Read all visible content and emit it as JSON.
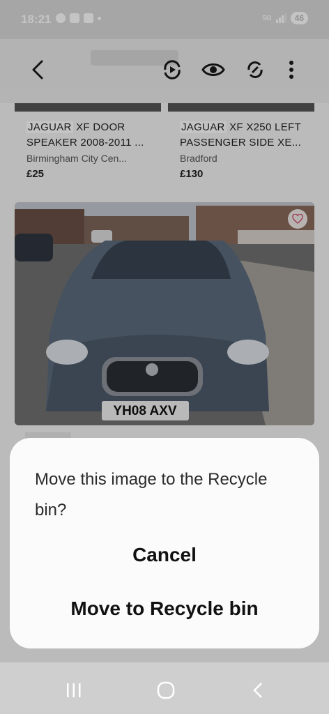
{
  "status": {
    "time": "18:21",
    "network": "5G",
    "battery": "46"
  },
  "listings": [
    {
      "title_highlight": "JAGUAR",
      "title_rest": " XF DOOR",
      "title_line2": "SPEAKER 2008-2011 ...",
      "location": "Birmingham City Cen...",
      "price": "£25"
    },
    {
      "title_highlight": "JAGUAR",
      "title_rest": " XF X250 LEFT",
      "title_line2": "PASSENGER SIDE XE...",
      "location": "Bradford",
      "price": "£130"
    }
  ],
  "photo": {
    "plate": "YH08 AXV"
  },
  "dialog": {
    "message": "Move this image to the Recycle bin?",
    "cancel": "Cancel",
    "confirm": "Move to Recycle bin"
  }
}
